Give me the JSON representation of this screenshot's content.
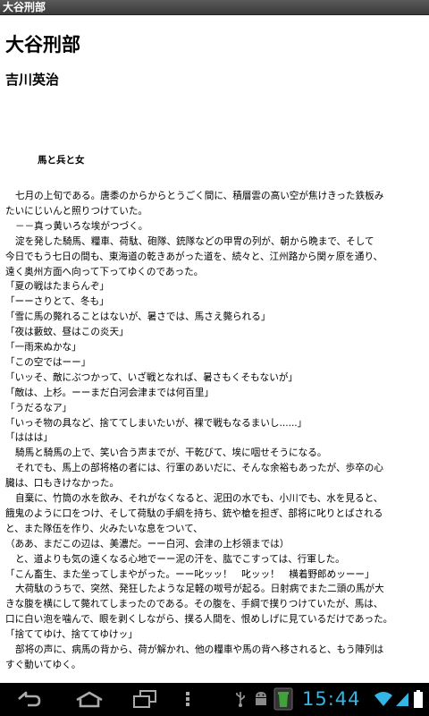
{
  "window": {
    "title": "大谷刑部"
  },
  "book": {
    "title": "大谷刑部",
    "author": "吉川英治",
    "chapter": "馬と兵と女"
  },
  "lines": [
    {
      "text": "七月の上旬である。唐黍のからからとうごく間に、積層雲の高い空が焦けきった鉄板み",
      "indent": true
    },
    {
      "text": "たいにじいんと照りつけていた。",
      "indent": false
    },
    {
      "text": "－－真っ黄いろな埃がつづく。",
      "indent": true
    },
    {
      "text": "淀を発した騎馬、糧車、荷駄、砲隊、銃隊などの甲冑の列が、朝から晩まで、そして",
      "indent": true
    },
    {
      "text": "今日でもう七日の間も、東海道の乾きあがった道を、続々と、江州路から関ヶ原を通り、",
      "indent": false
    },
    {
      "text": "遠く奥州方面へ向って下ってゆくのであった。",
      "indent": false
    },
    {
      "text": "「夏の戦はたまらんぞ」",
      "indent": false
    },
    {
      "text": "「ーーさりとて、冬も」",
      "indent": false
    },
    {
      "text": "「雪に馬の斃れることはないが、暑さでは、馬さえ斃られる」",
      "indent": false
    },
    {
      "text": "「夜は藪蚊、昼はこの炎天」",
      "indent": false
    },
    {
      "text": "「一雨来ぬかな」",
      "indent": false
    },
    {
      "text": "「この空ではーー」",
      "indent": false
    },
    {
      "text": "「いッそ、敵にぶつかって、いざ戦となれば、暑さもくそもないが」",
      "indent": false
    },
    {
      "text": "「敵は、上杉。ーーまだ白河会津までは何百里」",
      "indent": false
    },
    {
      "text": "「うだるなア」",
      "indent": false
    },
    {
      "text": "「いっそ物の具など、捨ててしまいたいが、裸で戦もなるまいし......」",
      "indent": false
    },
    {
      "text": "「ははは」",
      "indent": false
    },
    {
      "text": "騎馬と騎馬の上で、笑い合う声までが、干乾びて、埃に咽せそうになる。",
      "indent": true
    },
    {
      "text": "それでも、馬上の部将格の者には、行軍のあいだに、そんな余裕もあったが、歩卒の心",
      "indent": true
    },
    {
      "text": "臓は、口もきけなかった。",
      "indent": false
    },
    {
      "text": "自棄に、竹筒の水を飲み、それがなくなると、泥田の水でも、小川でも、水を見ると、",
      "indent": true
    },
    {
      "text": "餓鬼のように口をつけ、そして荷駄の手綱を持ち、銃や槍を担ぎ、部将に叱りとばされる",
      "indent": false
    },
    {
      "text": "と、また隊伍を作り、火みたいな息をついて、",
      "indent": false
    },
    {
      "text": "（ああ、まだこの辺は、美濃だ。ーー白河、会津の上杉領までは）",
      "indent": false
    },
    {
      "text": "と、道よりも気の遠くなる心地でーー泥の汗を、肱でこすっては、行軍した。",
      "indent": true
    },
    {
      "text": "「こん畜生、また坐ってしまやがった。ーー叱ッッ！　叱ッッ！　横着野郎めッーー」",
      "indent": false
    },
    {
      "text": "大荷駄のうちで、突然、発狂したような足軽の呶号が起る。日射病でまた二頭の馬が大",
      "indent": true
    },
    {
      "text": "きな腹を横にして斃れてしまったのである。その腹を、手綱で撲りつけていたが、馬は、",
      "indent": false
    },
    {
      "text": "口に白い泡を噛んで、眼を剥くしながら、撲る人間を、恨めしげに見ているだけであった。",
      "indent": false
    },
    {
      "text": "「捨ててゆけ、捨ててゆけッ」",
      "indent": false
    },
    {
      "text": "部将の声に、病馬の背から、荷が解かれ、他の糧車や馬の背へ移されると、もう陣列は",
      "indent": true
    },
    {
      "text": "すぐ動いてゆく。",
      "indent": false
    }
  ],
  "statusbar": {
    "time": "15:44",
    "icons": [
      "usb-icon",
      "android-debug-icon",
      "sd-card-icon",
      "wifi-icon",
      "signal-icon",
      "battery-icon"
    ]
  },
  "navbar": {
    "buttons": [
      "back-icon",
      "home-icon",
      "recent-apps-icon",
      "menu-icon"
    ]
  }
}
